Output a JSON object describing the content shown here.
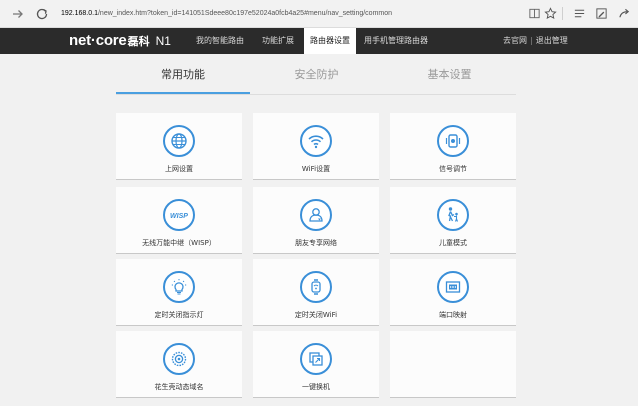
{
  "browser": {
    "url_host": "192.168.0.1",
    "url_path": "/new_index.htm?token_id=141051Sdeee80c197e52024a0fcb4a25#menu/nav_setting/common"
  },
  "header": {
    "brand": "net·core",
    "brand_cn": "磊科",
    "model": "N1",
    "menu": [
      {
        "label": "我的智能路由"
      },
      {
        "label": "功能扩展"
      },
      {
        "label": "路由器设置"
      },
      {
        "label": "用手机管理路由器"
      }
    ],
    "links": {
      "website": "去官网",
      "divider": "|",
      "logout": "退出管理"
    }
  },
  "tabs": [
    {
      "label": "常用功能"
    },
    {
      "label": "安全防护"
    },
    {
      "label": "基本设置"
    }
  ],
  "features": [
    {
      "label": "上网设置",
      "icon": "globe-icon"
    },
    {
      "label": "WiFi设置",
      "icon": "wifi-icon"
    },
    {
      "label": "信号调节",
      "icon": "signal-adjust-icon"
    },
    {
      "label": "无线万能中继（WISP）",
      "icon": "wisp-icon",
      "icon_text": "WISP"
    },
    {
      "label": "朋友专享网络",
      "icon": "friend-icon"
    },
    {
      "label": "儿童模式",
      "icon": "child-mode-icon"
    },
    {
      "label": "定时关闭指示灯",
      "icon": "light-bulb-icon"
    },
    {
      "label": "定时关闭WiFi",
      "icon": "wifi-timer-icon"
    },
    {
      "label": "端口映射",
      "icon": "port-mapping-icon"
    },
    {
      "label": "花生壳动态域名",
      "icon": "ddns-icon"
    },
    {
      "label": "一键换机",
      "icon": "device-replace-icon"
    }
  ],
  "colors": {
    "accent": "#3a8fd8",
    "header_bg": "#2b2b2b",
    "page_bg": "#f1f1f1"
  }
}
